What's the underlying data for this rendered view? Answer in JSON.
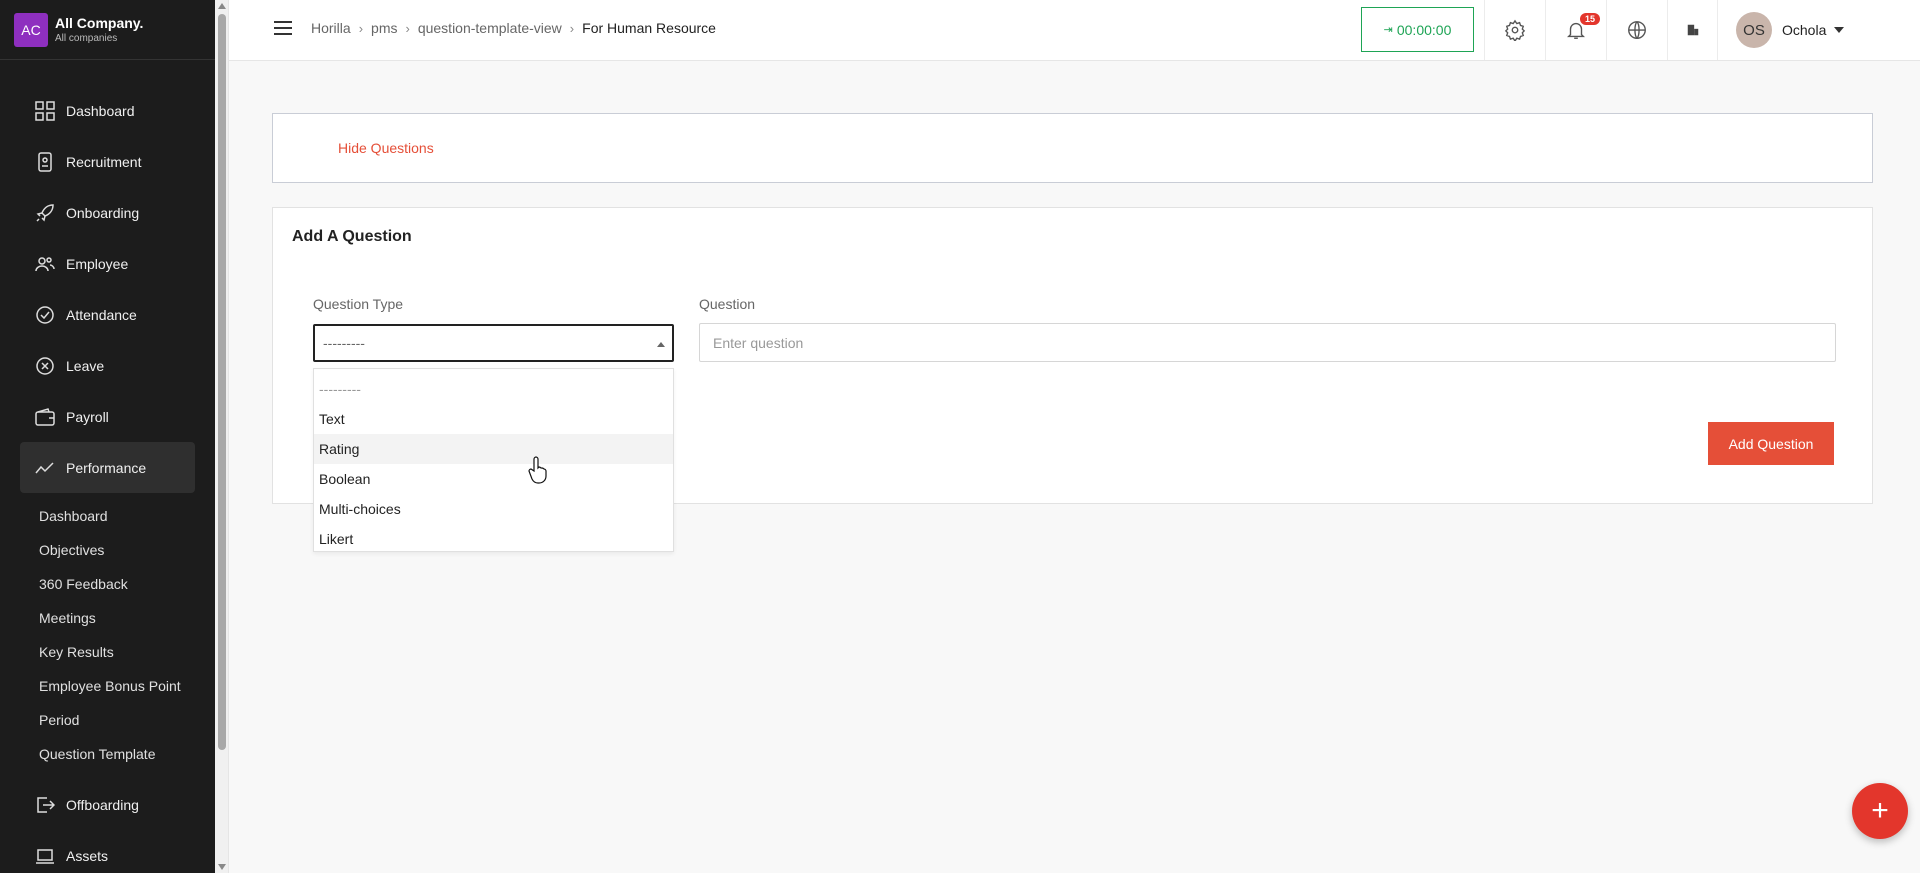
{
  "company": {
    "initials": "AC",
    "name": "All Company.",
    "subtitle": "All companies"
  },
  "sidebar": {
    "items": [
      {
        "label": "Dashboard",
        "icon": "dashboard-icon"
      },
      {
        "label": "Recruitment",
        "icon": "recruitment-icon"
      },
      {
        "label": "Onboarding",
        "icon": "rocket-icon"
      },
      {
        "label": "Employee",
        "icon": "people-icon"
      },
      {
        "label": "Attendance",
        "icon": "check-circle-icon"
      },
      {
        "label": "Leave",
        "icon": "x-circle-icon"
      },
      {
        "label": "Payroll",
        "icon": "wallet-icon"
      },
      {
        "label": "Performance",
        "icon": "trend-icon",
        "active": true
      }
    ],
    "performance_sub": [
      "Dashboard",
      "Objectives",
      "360 Feedback",
      "Meetings",
      "Key Results",
      "Employee Bonus Point",
      "Period",
      "Question Template"
    ],
    "after": [
      {
        "label": "Offboarding",
        "icon": "exit-icon"
      },
      {
        "label": "Assets",
        "icon": "laptop-icon"
      }
    ]
  },
  "header": {
    "breadcrumb": [
      "Horilla",
      "pms",
      "question-template-view",
      "For Human Resource"
    ],
    "timer": "00:00:00",
    "notification_count": "15",
    "user": {
      "initials": "OS",
      "name": "Ochola"
    }
  },
  "main": {
    "hide_questions_label": "Hide Questions",
    "add_title": "Add A Question",
    "question_type_label": "Question Type",
    "question_type_value": "---------",
    "question_label": "Question",
    "question_placeholder": "Enter question",
    "add_button": "Add Question",
    "options": [
      "---------",
      "Text",
      "Rating",
      "Boolean",
      "Multi-choices",
      "Likert"
    ],
    "hovered_option": "Rating"
  },
  "colors": {
    "accent": "#e54f38",
    "timer_green": "#1ea455",
    "sidebar_bg": "#1c1c1c",
    "company_logo": "#8e2fbf"
  }
}
